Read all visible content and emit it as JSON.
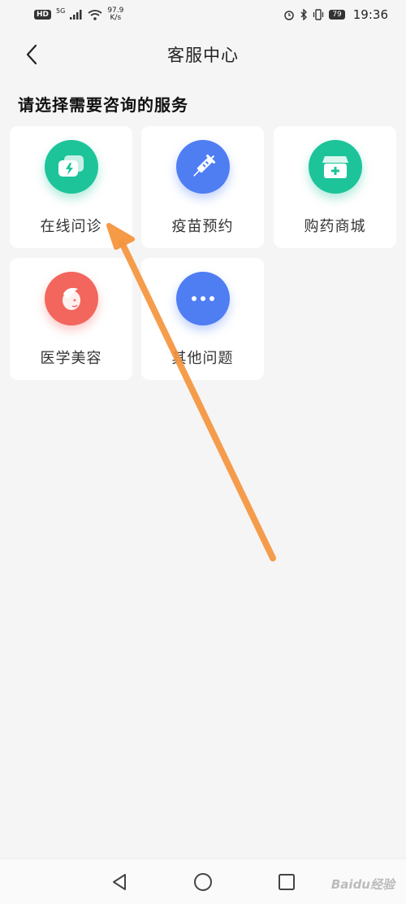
{
  "status_bar": {
    "hd": "HD",
    "network": "5G",
    "speed_value": "97.9",
    "speed_unit": "K/s",
    "battery": "79",
    "time": "19:36"
  },
  "nav": {
    "title": "客服中心",
    "back_icon": "chevron-left-icon"
  },
  "section_title": "请选择需要咨询的服务",
  "services": [
    {
      "label": "在线问诊",
      "icon": "chat-bolt-icon",
      "color": "#1dc49a"
    },
    {
      "label": "疫苗预约",
      "icon": "syringe-icon",
      "color": "#4f7ef3"
    },
    {
      "label": "购药商城",
      "icon": "medicine-box-icon",
      "color": "#1dc49a"
    },
    {
      "label": "医学美容",
      "icon": "beauty-face-icon",
      "color": "#f2665e"
    },
    {
      "label": "其他问题",
      "icon": "more-dots-icon",
      "color": "#4f7ef3"
    }
  ],
  "annotation": {
    "color": "#f5953e"
  },
  "bottom_nav": {
    "back": "triangle-back-icon",
    "home": "circle-home-icon",
    "recents": "square-recents-icon"
  },
  "watermark": "Baidu经验"
}
